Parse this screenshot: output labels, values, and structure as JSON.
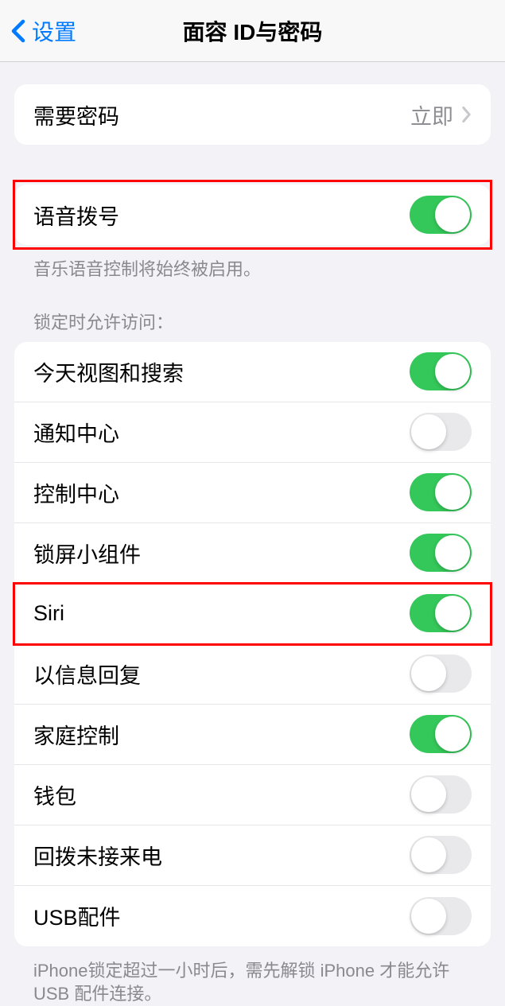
{
  "header": {
    "back_label": "设置",
    "title": "面容 ID与密码"
  },
  "passcode_row": {
    "label": "需要密码",
    "value": "立即"
  },
  "voice_dial": {
    "label": "语音拨号",
    "on": true,
    "footer": "音乐语音控制将始终被启用。"
  },
  "lock_access": {
    "header": "锁定时允许访问：",
    "items": [
      {
        "label": "今天视图和搜索",
        "on": true
      },
      {
        "label": "通知中心",
        "on": false
      },
      {
        "label": "控制中心",
        "on": true
      },
      {
        "label": "锁屏小组件",
        "on": true
      },
      {
        "label": "Siri",
        "on": true
      },
      {
        "label": "以信息回复",
        "on": false
      },
      {
        "label": "家庭控制",
        "on": true
      },
      {
        "label": "钱包",
        "on": false
      },
      {
        "label": "回拨未接来电",
        "on": false
      },
      {
        "label": "USB配件",
        "on": false
      }
    ],
    "footer": "iPhone锁定超过一小时后，需先解锁 iPhone 才能允许USB 配件连接。"
  }
}
